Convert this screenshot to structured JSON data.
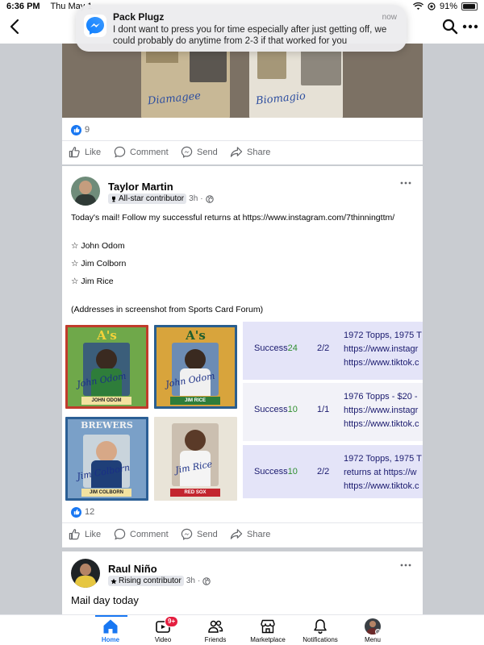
{
  "status_bar": {
    "time": "6:36 PM",
    "date": "Thu May 1",
    "battery": "91%"
  },
  "notification": {
    "app_icon": "messenger-icon",
    "title": "Pack Plugz",
    "time": "now",
    "body": "I dont want to press you for time especially after just getting off, we could probably do anytime from 2-3 if that worked for you"
  },
  "top_nav": {
    "back_icon": "chevron-left-icon",
    "search_icon": "search-icon",
    "more_icon": "more-horizontal-icon"
  },
  "post_prev": {
    "image_signatures": [
      "Diamagee",
      "Biomagio"
    ],
    "reaction_count": "9",
    "actions": {
      "like": "Like",
      "comment": "Comment",
      "send": "Send",
      "share": "Share"
    }
  },
  "post_main": {
    "author": "Taylor Martin",
    "badge": "All-star contributor",
    "time": "3h",
    "text_line1": "Today's mail! Follow my successful returns at https://www.instagram.com/7thinningttm/",
    "items": [
      "☆ John Odom",
      "☆ Jim Colborn",
      "☆ Jim Rice"
    ],
    "note": "(Addresses in screenshot from Sports Card Forum)",
    "card_images": [
      {
        "team": "A's",
        "player": "JOHN ODOM",
        "sig": "John Odom"
      },
      {
        "team": "A's",
        "player": "JIM RICE",
        "sig": "John Odom"
      },
      {
        "team": "BREWERS",
        "player": "JIM COLBORN",
        "sig": "Jim Colborn"
      },
      {
        "team": "",
        "player": "RED SOX",
        "sig": "Jim Rice"
      }
    ],
    "screenshot_rows": [
      {
        "label": "Success",
        "num": "24",
        "frac": "2/2",
        "lines": [
          "1972 Topps, 1975 T",
          "https://www.instagr",
          "https://www.tiktok.c"
        ]
      },
      {
        "label": "Success",
        "num": "10",
        "frac": "1/1",
        "lines": [
          "1976 Topps - $20 -",
          "https://www.instagr",
          "https://www.tiktok.c"
        ]
      },
      {
        "label": "Success",
        "num": "10",
        "frac": "2/2",
        "lines": [
          "1972 Topps, 1975 T",
          "returns at https://w",
          "https://www.tiktok.c"
        ]
      }
    ],
    "reaction_count": "12",
    "actions": {
      "like": "Like",
      "comment": "Comment",
      "send": "Send",
      "share": "Share"
    }
  },
  "post_next": {
    "author": "Raul Niño",
    "badge": "Rising contributor",
    "time": "3h",
    "text": "Mail day today"
  },
  "tab_bar": {
    "tabs": [
      {
        "label": "Home",
        "icon": "home-icon",
        "active": true
      },
      {
        "label": "Video",
        "icon": "video-icon",
        "badge": "9+"
      },
      {
        "label": "Friends",
        "icon": "friends-icon"
      },
      {
        "label": "Marketplace",
        "icon": "marketplace-icon"
      },
      {
        "label": "Notifications",
        "icon": "bell-icon"
      },
      {
        "label": "Menu",
        "icon": "avatar"
      }
    ]
  },
  "colors": {
    "accent": "#1877f2",
    "badge_red": "#e41e3f",
    "feed_bg": "#c9ccd1",
    "screenshot_row": "#e8e8f8"
  }
}
